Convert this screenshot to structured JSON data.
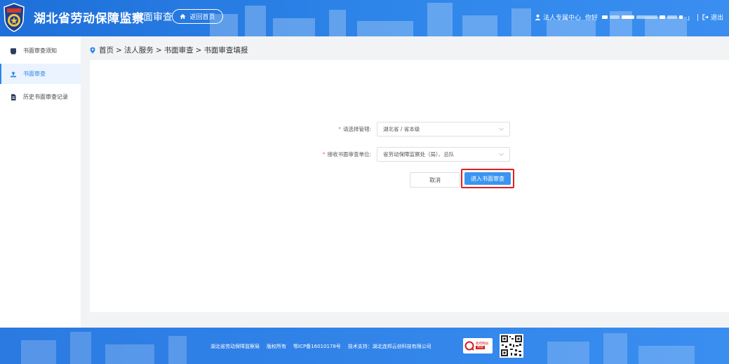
{
  "header": {
    "site_title": "湖北省劳动保障监察",
    "separator": "|",
    "section_title": "书面审查",
    "home_button": "返回首页",
    "user_center": "法人专属中心",
    "greeting": "你好",
    "greeting_tail": "」",
    "logout": "退出"
  },
  "sidebar": {
    "items": [
      {
        "label": "书面审查须知",
        "icon": "book-icon"
      },
      {
        "label": "书面审查",
        "icon": "upload-icon"
      },
      {
        "label": "历史书面审查记录",
        "icon": "document-icon"
      }
    ]
  },
  "breadcrumb": {
    "items": [
      "首页",
      "法人服务",
      "书面审查",
      "书面审查填报"
    ],
    "separator": ">"
  },
  "form": {
    "jurisdiction_label": "请选择管辖:",
    "jurisdiction_value": "湖北省 / 省本级",
    "unit_label": "接收书面审查单位:",
    "unit_value": "省劳动保障监察处（局）、总队",
    "required_mark": "*",
    "cancel_button": "取消",
    "enter_button": "进入书面审查"
  },
  "footer": {
    "org": "湖北省劳动保障监察局",
    "rights": "版权所有",
    "icp": "鄂ICP备16010178号",
    "tech_support": "技术支持：湖北连邦云创科技有限公司",
    "badge_line1": "政府网站",
    "badge_line2": "找错"
  },
  "colors": {
    "header_blue": "#2f86ea",
    "accent": "#2d86e9",
    "primary_button": "#3b95f0",
    "highlight_border": "#e02020",
    "required": "#f56c6c"
  }
}
